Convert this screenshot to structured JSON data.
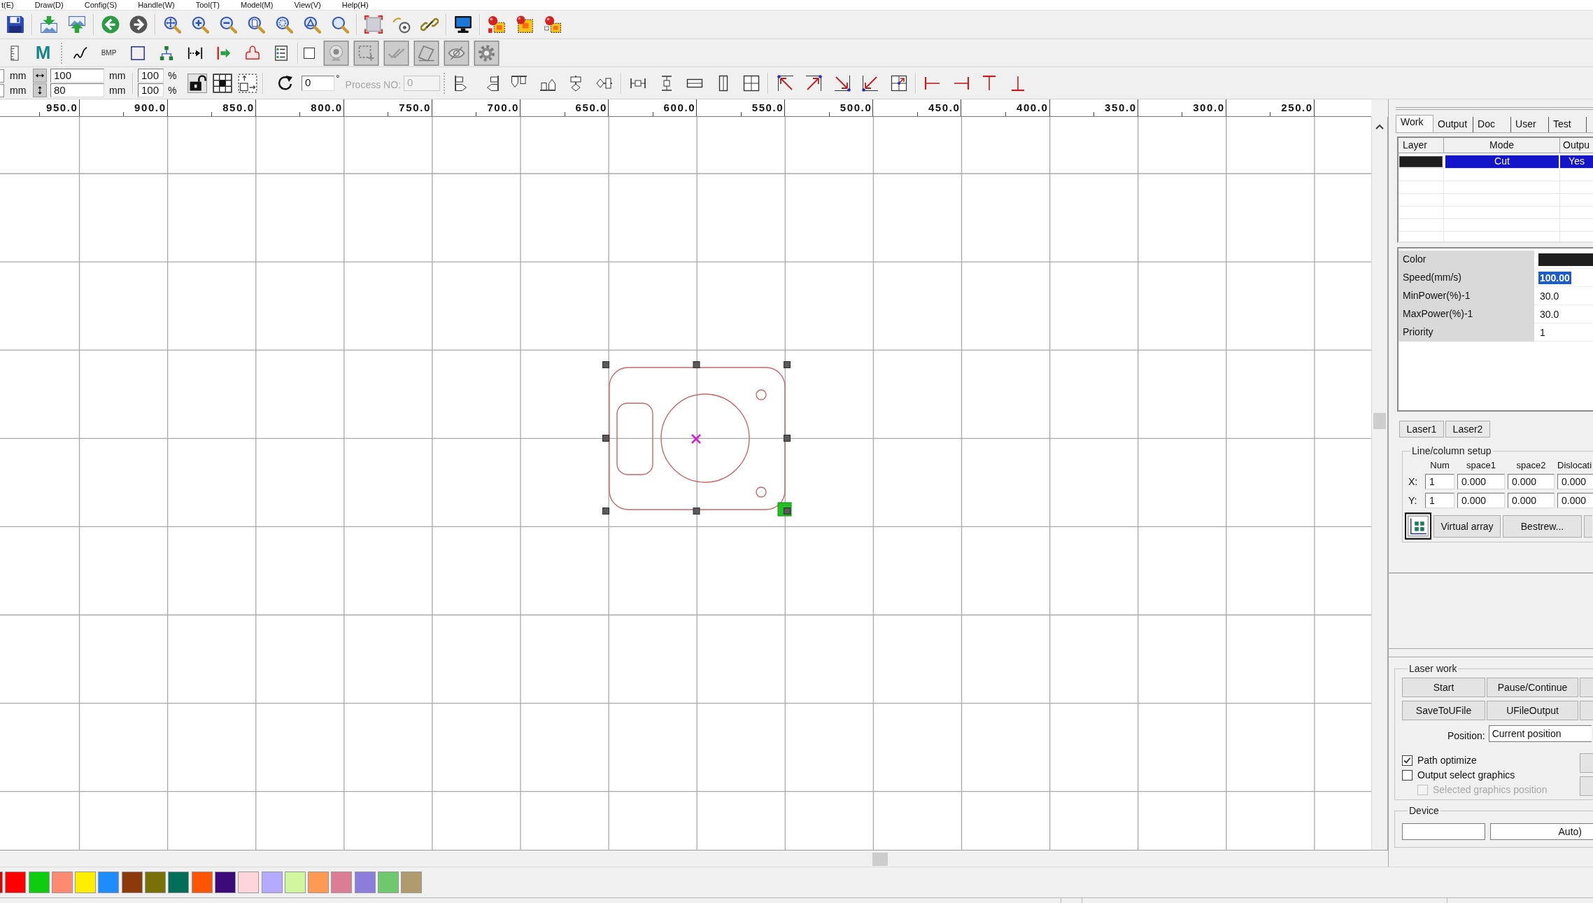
{
  "menu_bar": [
    "t(E)",
    "Draw(D)",
    "Config(S)",
    "Handle(W)",
    "Tool(T)",
    "Model(M)",
    "View(V)",
    "Help(H)"
  ],
  "draw_toolbar": {
    "text_tools": [
      {
        "kind": "letter",
        "label": "M"
      },
      {
        "kind": "caption",
        "label": "BMP"
      }
    ],
    "checkbox": {
      "checked": false
    }
  },
  "size_bar": {
    "position_units": [
      "mm",
      "mm"
    ],
    "size": [
      {
        "value": "100",
        "unit": "mm"
      },
      {
        "value": "80",
        "unit": "mm"
      }
    ],
    "scale": [
      {
        "value": "100",
        "unit": "%"
      },
      {
        "value": "100",
        "unit": "%"
      }
    ],
    "rotation": {
      "value": "0",
      "unit": "°"
    },
    "process_no": {
      "label": "Process NO:",
      "value": "0",
      "disabled": true
    }
  },
  "ruler": {
    "labels": [
      "950.0",
      "900.0",
      "850.0",
      "800.0",
      "750.0",
      "700.0",
      "650.0",
      "600.0",
      "550.0",
      "500.0",
      "450.0",
      "400.0",
      "350.0",
      "300.0",
      "250.0"
    ]
  },
  "side_panel": {
    "tabs": [
      {
        "label": "Work",
        "selected": true
      },
      {
        "label": "Output",
        "selected": false
      },
      {
        "label": "Doc",
        "selected": false
      },
      {
        "label": "User",
        "selected": false
      },
      {
        "label": "Test",
        "selected": false
      }
    ],
    "layers": {
      "columns": [
        "Layer",
        "Mode",
        "Outpu"
      ],
      "rows": [
        {
          "color": "#1e1e1e",
          "mode": "Cut",
          "output": "Yes",
          "selected": true
        }
      ]
    },
    "properties": [
      {
        "kind": "color",
        "label": "Color",
        "color": "#1e1e1e"
      },
      {
        "kind": "text",
        "label": "Speed(mm/s)",
        "value": "100.00",
        "highlighted": true
      },
      {
        "kind": "text",
        "label": "MinPower(%)-1",
        "value": "30.0",
        "highlighted": false
      },
      {
        "kind": "text",
        "label": "MaxPower(%)-1",
        "value": "30.0",
        "highlighted": false
      },
      {
        "kind": "text",
        "label": "Priority",
        "value": "1",
        "highlighted": false
      }
    ],
    "laser_tabs": [
      {
        "label": "Laser1",
        "selected": false
      },
      {
        "label": "Laser2",
        "selected": false
      }
    ],
    "array_setup": {
      "title": "Line/column setup",
      "columns": [
        "Num",
        "space1",
        "space2",
        "Dislocati"
      ],
      "rows": [
        {
          "label": "X:",
          "values": [
            "1",
            "0.000",
            "0.000",
            "0.000"
          ]
        },
        {
          "label": "Y:",
          "values": [
            "1",
            "0.000",
            "0.000",
            "0.000"
          ]
        }
      ],
      "buttons": [
        "Virtual array",
        "Bestrew..."
      ]
    },
    "laser_work": {
      "title": "Laser work",
      "buttons": [
        "Start",
        "Pause/Continue",
        "SaveToUFile",
        "UFileOutput"
      ],
      "position": {
        "label": "Position:",
        "value": "Current position"
      },
      "options": [
        {
          "label": "Path optimize",
          "checked": true,
          "disabled": false
        },
        {
          "label": "Output select graphics",
          "checked": false,
          "disabled": false,
          "children": [
            {
              "label": "Selected graphics position",
              "checked": false,
              "disabled": true
            }
          ]
        }
      ]
    },
    "device": {
      "title": "Device",
      "port": "Auto)"
    }
  },
  "color_palette": [
    {
      "color": "#e00000"
    },
    {
      "color": "#ff0000"
    },
    {
      "color": "#10cc10"
    },
    {
      "color": "#ff8a70"
    },
    {
      "color": "#ffee00"
    },
    {
      "color": "#1e8cff"
    },
    {
      "color": "#8c3a0a"
    },
    {
      "color": "#7a7008"
    },
    {
      "color": "#006e58"
    },
    {
      "color": "#ff5500"
    },
    {
      "color": "#3c0a7a"
    },
    {
      "color": "#ffd5dc"
    },
    {
      "color": "#b4aaff"
    },
    {
      "color": "#d2f5a0"
    },
    {
      "color": "#ff9a55"
    },
    {
      "color": "#dc7d96"
    },
    {
      "color": "#8c7ddc"
    },
    {
      "color": "#6ec86e"
    },
    {
      "color": "#b09b6e"
    }
  ]
}
